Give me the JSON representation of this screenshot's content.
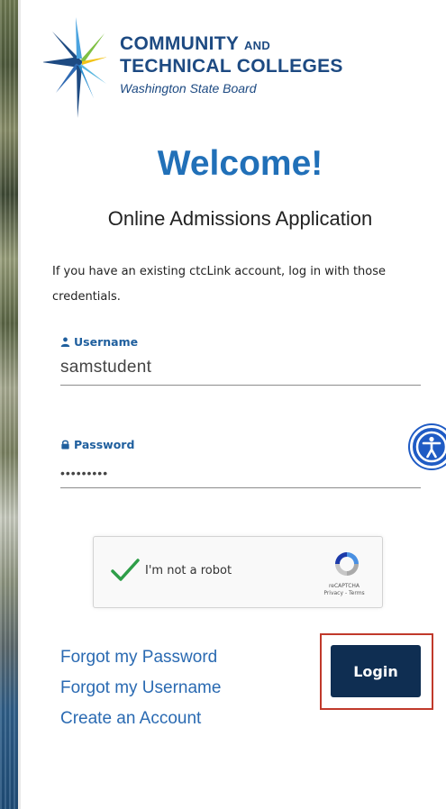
{
  "logo": {
    "line1_main": "COMMUNITY",
    "line1_small": "AND",
    "line2": "TECHNICAL COLLEGES",
    "line3": "Washington State Board"
  },
  "header": {
    "welcome": "Welcome!",
    "subtitle": "Online Admissions Application"
  },
  "info_text": "If you have an existing ctcLink account, log in with those credentials.",
  "username": {
    "label": "Username",
    "value": "samstudent"
  },
  "password": {
    "label": "Password",
    "value": "•••••••••"
  },
  "captcha": {
    "label": "I'm not a robot",
    "brand": "reCAPTCHA",
    "links": "Privacy - Terms"
  },
  "links": {
    "forgot_password": "Forgot my Password",
    "forgot_username": "Forgot my Username",
    "create_account": "Create an Account"
  },
  "login_button": "Login",
  "colors": {
    "brand_blue": "#1d4a82",
    "welcome_blue": "#2170b8",
    "link_blue": "#2a6ab2",
    "button_navy": "#0f2e52",
    "highlight_red": "#c0392b"
  },
  "icons": {
    "username": "user-icon",
    "password": "lock-icon",
    "accessibility": "accessibility-icon",
    "captcha_check": "checkmark-icon",
    "captcha_logo": "recaptcha-icon"
  }
}
